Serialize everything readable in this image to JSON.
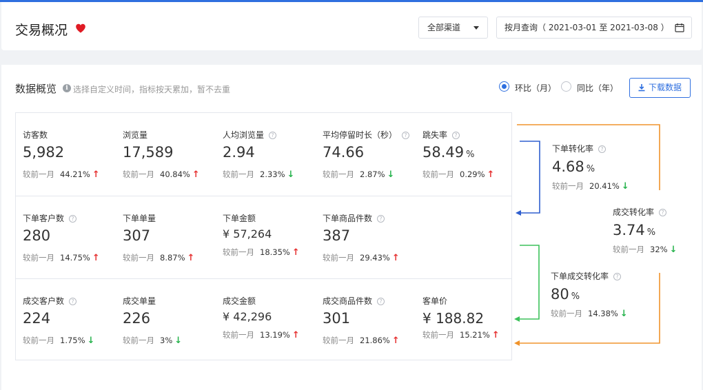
{
  "header": {
    "title": "交易概况",
    "channel_select": "全部渠道",
    "date_query": "按月查询（ 2021-03-01 至 2021-03-08 ）"
  },
  "overview": {
    "title": "数据概览",
    "hint": "选择自定义时间，指标按天累加，暂不去重",
    "radio_mom": "环比（月）",
    "radio_yoy": "同比（年）",
    "download": "下载数据",
    "compare_label": "较前一月"
  },
  "metrics": [
    [
      {
        "label": "访客数",
        "help": false,
        "value": "5,982",
        "unit": "",
        "pct": "44.21%",
        "trend": "up",
        "money": false
      },
      {
        "label": "浏览量",
        "help": false,
        "value": "17,589",
        "unit": "",
        "pct": "40.84%",
        "trend": "up",
        "money": false
      },
      {
        "label": "人均浏览量",
        "help": true,
        "value": "2.94",
        "unit": "",
        "pct": "2.33%",
        "trend": "down",
        "money": false
      },
      {
        "label": "平均停留时长（秒）",
        "help": true,
        "value": "74.66",
        "unit": "",
        "pct": "2.87%",
        "trend": "down",
        "money": false
      },
      {
        "label": "跳失率",
        "help": true,
        "value": "58.49",
        "unit": "%",
        "pct": "0.29%",
        "trend": "up",
        "money": false
      }
    ],
    [
      {
        "label": "下单客户数",
        "help": true,
        "value": "280",
        "unit": "",
        "pct": "14.75%",
        "trend": "up",
        "money": false
      },
      {
        "label": "下单单量",
        "help": false,
        "value": "307",
        "unit": "",
        "pct": "8.87%",
        "trend": "up",
        "money": false
      },
      {
        "label": "下单金额",
        "help": false,
        "value": "¥ 57,264",
        "unit": "",
        "pct": "18.35%",
        "trend": "up",
        "money": true
      },
      {
        "label": "下单商品件数",
        "help": true,
        "value": "387",
        "unit": "",
        "pct": "29.43%",
        "trend": "up",
        "money": false
      }
    ],
    [
      {
        "label": "成交客户数",
        "help": true,
        "value": "224",
        "unit": "",
        "pct": "1.75%",
        "trend": "down",
        "money": false
      },
      {
        "label": "成交单量",
        "help": false,
        "value": "226",
        "unit": "",
        "pct": "3%",
        "trend": "down",
        "money": false
      },
      {
        "label": "成交金额",
        "help": false,
        "value": "¥ 42,296",
        "unit": "",
        "pct": "13.19%",
        "trend": "up",
        "money": true
      },
      {
        "label": "成交商品件数",
        "help": true,
        "value": "301",
        "unit": "",
        "pct": "21.86%",
        "trend": "up",
        "money": false
      },
      {
        "label": "客单价",
        "help": false,
        "value": "¥ 188.82",
        "unit": "",
        "pct": "15.21%",
        "trend": "up",
        "money": true,
        "big": true
      }
    ]
  ],
  "funnel": {
    "order_rate": {
      "label": "下单转化率",
      "value": "4.68",
      "unit": "%",
      "pct": "20.41%",
      "trend": "down"
    },
    "deal_rate": {
      "label": "成交转化率",
      "value": "3.74",
      "unit": "%",
      "pct": "32%",
      "trend": "down"
    },
    "order_deal_rate": {
      "label": "下单成交转化率",
      "value": "80",
      "unit": "%",
      "pct": "14.38%",
      "trend": "down"
    }
  },
  "colors": {
    "accent": "#2f6fdf",
    "up": "#e63333",
    "down": "#27b34d",
    "flow_orange": "#f0932b",
    "flow_blue": "#2f5fcf",
    "flow_green": "#3cc15a"
  }
}
